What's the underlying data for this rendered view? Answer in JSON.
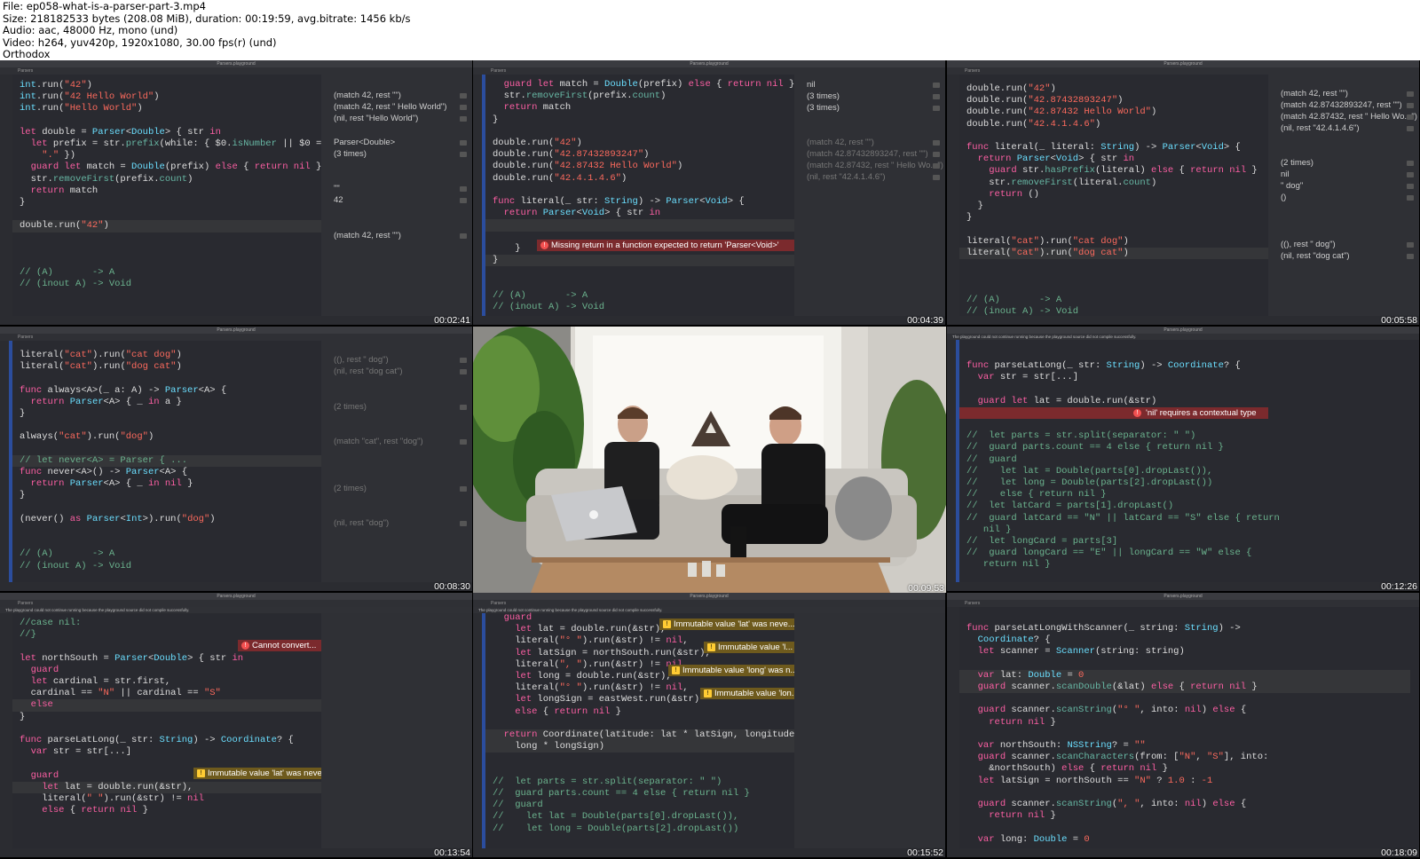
{
  "header": {
    "lines": [
      "File: ep058-what-is-a-parser-part-3.mp4",
      "Size: 218182533 bytes (208.08 MiB), duration: 00:19:59, avg.bitrate: 1456 kb/s",
      "Audio: aac, 48000 Hz, mono (und)",
      "Video: h264, yuv420p, 1920x1080, 30.00 fps(r) (und)",
      "Orthodox"
    ]
  },
  "window_title": "Parsers.playground",
  "breadcrumb": "Parsers",
  "compile_notice": "The playground could not continue running because the playground source did not compile successfully.",
  "colors": {
    "editor_bg": "#292a30",
    "keyword": "#fc5fa3",
    "type": "#6bdfff",
    "string": "#fc6a5d",
    "comment": "#6bb38e",
    "error": "#7b2a2d",
    "warning": "#6e5a1d"
  },
  "tiles": [
    {
      "timestamp": "00:02:41",
      "results": [
        {
          "text": "(match 42, rest \"\")"
        },
        {
          "text": "(match 42, rest \" Hello World\")"
        },
        {
          "text": "(nil, rest \"Hello World\")"
        },
        {
          "text": "Parser<Double>"
        },
        {
          "text": "(3 times)"
        },
        {
          "text": "\"\""
        },
        {
          "text": "42"
        },
        {
          "text": "(match 42, rest \"\")"
        }
      ]
    },
    {
      "timestamp": "00:04:39",
      "error": "Missing return in a function expected to return 'Parser<Void>'",
      "results": [
        {
          "text": "nil"
        },
        {
          "text": "(3 times)"
        },
        {
          "text": "(3 times)"
        },
        {
          "text": "(match 42, rest \"\")"
        },
        {
          "text": "(match 42.87432893247, rest \"\")"
        },
        {
          "text": "(match 42.87432, rest \" Hello Wo...\")"
        },
        {
          "text": "(nil, rest \"42.4.1.4.6\")"
        }
      ]
    },
    {
      "timestamp": "00:05:58",
      "results": [
        {
          "text": "(match 42, rest \"\")"
        },
        {
          "text": "(match 42.87432893247, rest \"\")"
        },
        {
          "text": "(match 42.87432, rest \" Hello Wo...\")"
        },
        {
          "text": "(nil, rest \"42.4.1.4.6\")"
        },
        {
          "text": "(2 times)"
        },
        {
          "text": "nil"
        },
        {
          "text": "\" dog\""
        },
        {
          "text": "()"
        },
        {
          "text": "((), rest \" dog\")"
        },
        {
          "text": "(nil, rest \"dog cat\")"
        }
      ]
    },
    {
      "timestamp": "00:08:30",
      "results": [
        {
          "text": "((), rest \" dog\")"
        },
        {
          "text": "(nil, rest \"dog cat\")"
        },
        {
          "text": "(2 times)"
        },
        {
          "text": "(match \"cat\", rest \"dog\")"
        },
        {
          "text": "(2 times)"
        },
        {
          "text": "(nil, rest \"dog\")"
        }
      ]
    },
    {
      "timestamp": "00:09:53"
    },
    {
      "timestamp": "00:12:26",
      "error": "'nil' requires a contextual type"
    },
    {
      "timestamp": "00:13:54",
      "error": "Cannot convert...",
      "warning": "Immutable value 'lat' was neve..."
    },
    {
      "timestamp": "00:15:52",
      "warnings": [
        "Immutable value 'lat' was neve...",
        "Immutable value 'l...",
        "Immutable value 'long' was n...",
        "Immutable value 'lon..."
      ]
    },
    {
      "timestamp": "00:18:09"
    }
  ]
}
